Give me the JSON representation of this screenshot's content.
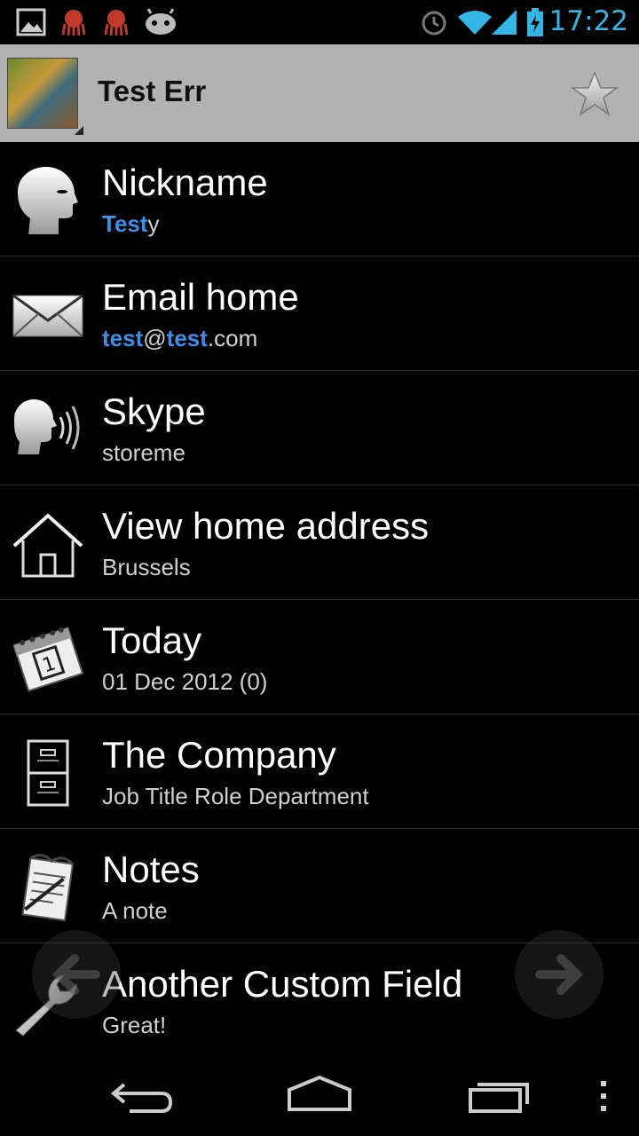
{
  "status_bar": {
    "time": "17:22",
    "icons": [
      "gallery-icon",
      "octopus-icon",
      "octopus-icon",
      "android-icon",
      "alarm-icon",
      "wifi-icon",
      "signal-icon",
      "battery-charging-icon"
    ]
  },
  "header": {
    "name": "Test Err",
    "favorite": false
  },
  "fields": [
    {
      "icon": "head-icon",
      "title": "Nickname",
      "value_hl": "Test",
      "value_rest": "y"
    },
    {
      "icon": "envelope-icon",
      "title": "Email home",
      "value_parts": [
        {
          "text": "test",
          "hl": true
        },
        {
          "text": "@",
          "hl": false
        },
        {
          "text": "test",
          "hl": true
        },
        {
          "text": ".com",
          "hl": false
        }
      ]
    },
    {
      "icon": "speaking-head-icon",
      "title": "Skype",
      "value": "storeme"
    },
    {
      "icon": "house-icon",
      "title": "View home address",
      "value": "Brussels"
    },
    {
      "icon": "calendar-icon",
      "title": "Today",
      "value": "01 Dec 2012 (0)"
    },
    {
      "icon": "file-cabinet-icon",
      "title": "The Company",
      "value": "Job Title Role Department"
    },
    {
      "icon": "notepad-icon",
      "title": "Notes",
      "value": "A note"
    },
    {
      "icon": "wrench-icon",
      "title": "Another Custom Field",
      "value": "Great!"
    }
  ],
  "colors": {
    "accent": "#33b5e5",
    "highlight": "#3b8fe8",
    "header_bg": "#b2b2b2"
  }
}
